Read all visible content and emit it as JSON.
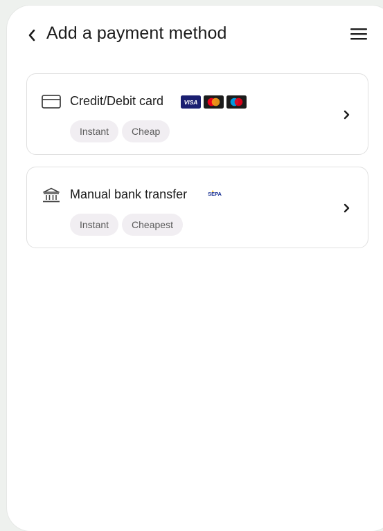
{
  "header": {
    "title": "Add a payment method",
    "back_icon": "chevron-left-icon",
    "menu_icon": "hamburger-menu-icon"
  },
  "methods": [
    {
      "title": "Credit/Debit card",
      "icon": "credit-card-icon",
      "logos": [
        "VISA",
        "mastercard-logo",
        "maestro-logo"
      ],
      "tags": [
        "Instant",
        "Cheap"
      ]
    },
    {
      "title": "Manual bank transfer",
      "icon": "bank-icon",
      "logos": [
        "SEPA"
      ],
      "tags": [
        "Instant",
        "Cheapest"
      ]
    }
  ],
  "colors": {
    "background": "#eef1ee",
    "card_border": "#e0e0e0",
    "tag_bg": "#f1eef2",
    "visa_blue": "#1a1f71",
    "mastercard_red": "#eb001b",
    "mastercard_orange": "#f79e1b",
    "maestro_blue": "#0099df"
  }
}
